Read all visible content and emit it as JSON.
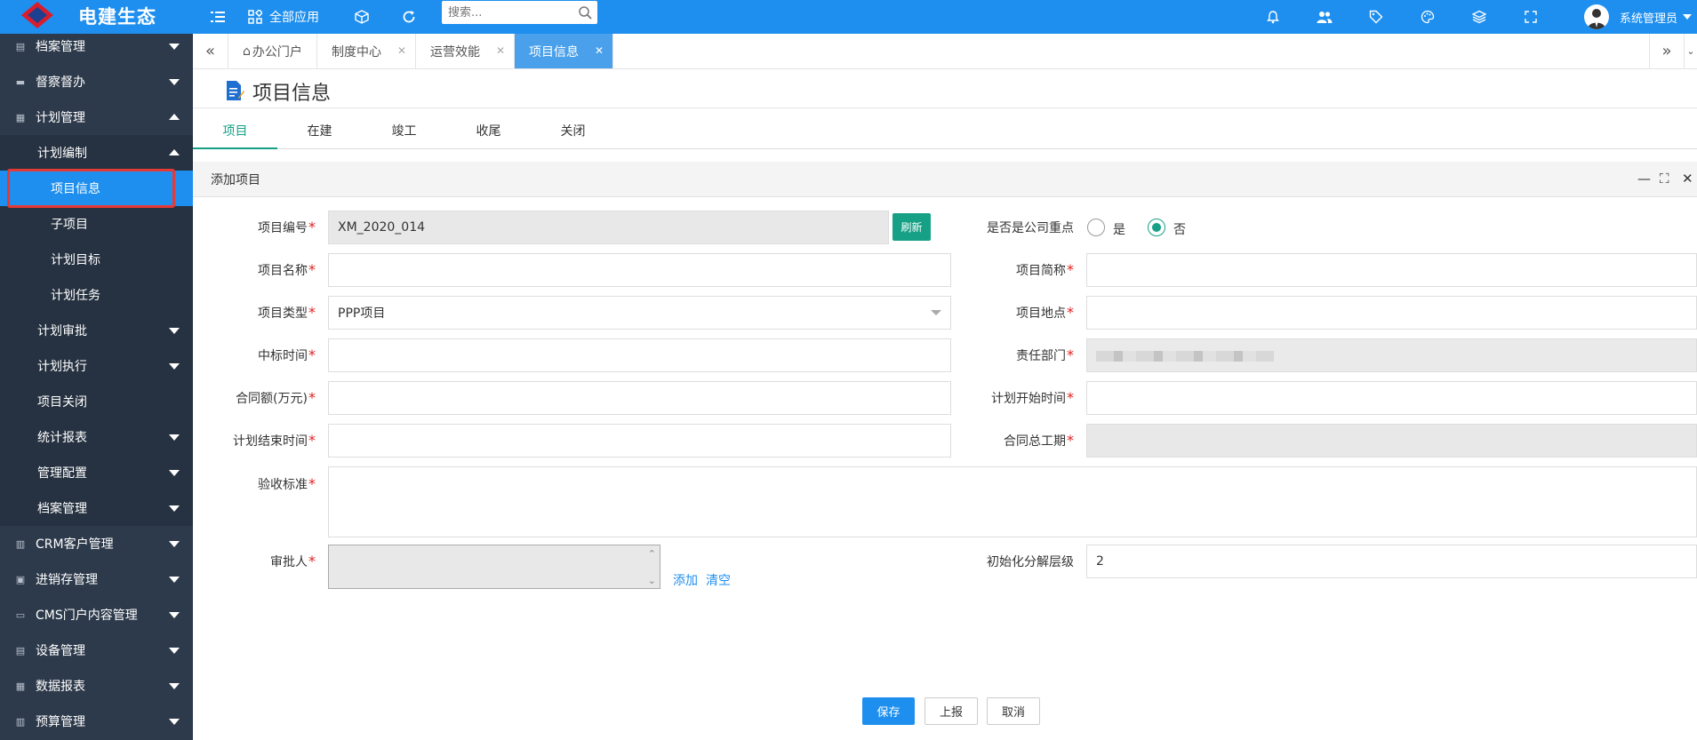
{
  "brand": {
    "name": "电建生态",
    "accent": "#1e8fef"
  },
  "sidebar": {
    "items": [
      {
        "label": "档案管理",
        "icon": "file-icon"
      },
      {
        "label": "督察督办",
        "icon": "monitor-icon"
      },
      {
        "label": "计划管理",
        "icon": "plan-icon"
      },
      {
        "label": "计划编制"
      },
      {
        "label": "项目信息"
      },
      {
        "label": "子项目"
      },
      {
        "label": "计划目标"
      },
      {
        "label": "计划任务"
      },
      {
        "label": "计划审批"
      },
      {
        "label": "计划执行"
      },
      {
        "label": "项目关闭"
      },
      {
        "label": "统计报表"
      },
      {
        "label": "管理配置"
      },
      {
        "label": "档案管理"
      },
      {
        "label": "CRM客户管理",
        "icon": "crm-icon"
      },
      {
        "label": "进销存管理",
        "icon": "inventory-icon"
      },
      {
        "label": "CMS门户内容管理",
        "icon": "cms-icon"
      },
      {
        "label": "设备管理",
        "icon": "device-icon"
      },
      {
        "label": "数据报表",
        "icon": "report-icon"
      },
      {
        "label": "预算管理",
        "icon": "budget-icon"
      }
    ]
  },
  "topbar": {
    "all_apps": "全部应用",
    "search_placeholder": "搜索...",
    "user_name": "系统管理员"
  },
  "tabs": [
    {
      "label": "办公门户"
    },
    {
      "label": "制度中心"
    },
    {
      "label": "运营效能"
    },
    {
      "label": "项目信息"
    }
  ],
  "page": {
    "title": "项目信息"
  },
  "subtabs": [
    "项目",
    "在建",
    "竣工",
    "收尾",
    "关闭"
  ],
  "panel": {
    "title": "添加项目"
  },
  "form": {
    "project_no_label": "项目编号",
    "project_no_value": "XM_2020_014",
    "refresh_label": "刷新",
    "key_project_label": "是否是公司重点",
    "yes_label": "是",
    "no_label": "否",
    "project_name_label": "项目名称",
    "project_short_label": "项目简称",
    "project_type_label": "项目类型",
    "project_type_value": "PPP项目",
    "project_location_label": "项目地点",
    "bid_time_label": "中标时间",
    "dept_label": "责任部门",
    "contract_amount_label": "合同额(万元)",
    "plan_start_label": "计划开始时间",
    "plan_end_label": "计划结束时间",
    "contract_period_label": "合同总工期",
    "acceptance_label": "验收标准",
    "approver_label": "审批人",
    "add_link": "添加",
    "clear_link": "清空",
    "init_level_label": "初始化分解层级",
    "init_level_value": "2"
  },
  "actions": {
    "save": "保存",
    "report": "上报",
    "cancel": "取消"
  }
}
